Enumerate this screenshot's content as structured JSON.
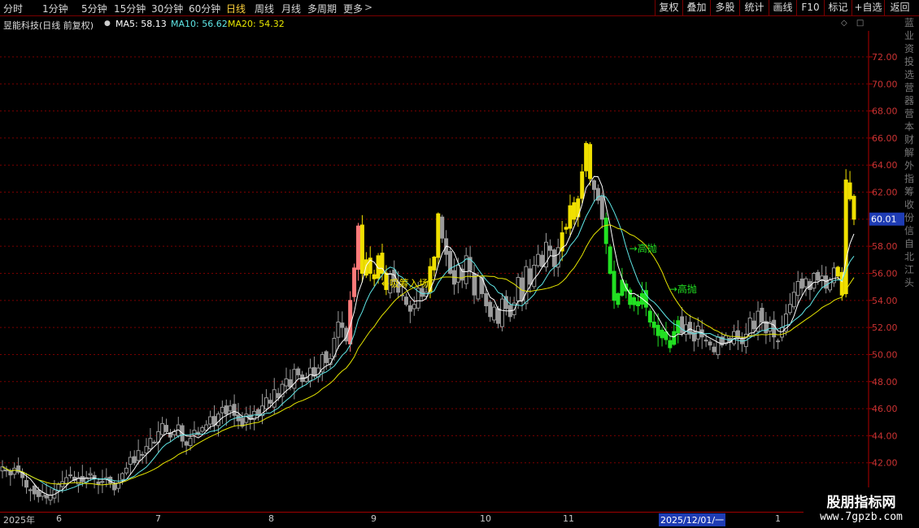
{
  "toolbar": {
    "periods": [
      "分时",
      "1分钟",
      "5分钟",
      "15分钟",
      "30分钟",
      "60分钟",
      "日线",
      "周线",
      "月线",
      "多周期",
      "更多"
    ],
    "active_period": "日线",
    "buttons": [
      "复权",
      "叠加",
      "多股",
      "统计",
      "画线",
      "F10",
      "标记",
      "+自选",
      "返回"
    ]
  },
  "info": {
    "stock": "昱能科技(日线 前复权)",
    "ma5": "MA5: 58.13",
    "ma10": "MA10: 56.62",
    "ma20": "MA20: 54.32",
    "colors": {
      "ma5": "#ffffff",
      "ma10": "#5fe6e6",
      "ma20": "#e6e600"
    }
  },
  "controls": {
    "diamond": "◇",
    "square": "□"
  },
  "right_panel": [
    "蓝",
    "业",
    "资",
    "投",
    "选",
    "营",
    "器",
    "营",
    "本",
    "财",
    "解",
    "外",
    "指",
    "筹",
    "收",
    "份",
    "信",
    "自",
    "北",
    "江",
    "头"
  ],
  "watermark": {
    "title": "股朋指标网",
    "url": "www.7gpzb.com"
  },
  "chart_data": {
    "type": "candlestick",
    "y_ticks": [
      "42.00",
      "44.00",
      "46.00",
      "48.00",
      "50.00",
      "52.00",
      "54.00",
      "56.00",
      "58.00",
      "60.00",
      "62.00",
      "64.00",
      "66.00",
      "68.00",
      "70.00",
      "72.00"
    ],
    "ylim": [
      38.5,
      73.5
    ],
    "current_price": "60.01",
    "x_labels": [
      "2025年",
      "6",
      "7",
      "8",
      "9",
      "10",
      "11",
      "2025/12/01/一",
      "1"
    ],
    "annotations": [
      "吸筹入场",
      "高抛",
      "高抛"
    ],
    "series": [
      {
        "name": "MA5",
        "color": "#ffffff"
      },
      {
        "name": "MA10",
        "color": "#5fe6e6"
      },
      {
        "name": "MA20",
        "color": "#e6e600"
      }
    ],
    "closes": [
      41.7,
      41.4,
      41.1,
      41.6,
      41.3,
      40.9,
      40.2,
      40.0,
      39.7,
      39.5,
      39.8,
      39.4,
      39.6,
      40.0,
      40.4,
      40.6,
      40.9,
      41.1,
      40.7,
      40.9,
      40.6,
      40.9,
      41.2,
      40.8,
      40.4,
      40.6,
      40.9,
      40.5,
      40.0,
      40.5,
      41.2,
      41.6,
      42.4,
      42.0,
      42.9,
      42.6,
      43.2,
      43.8,
      43.5,
      44.3,
      44.9,
      44.3,
      43.9,
      44.3,
      44.8,
      43.6,
      43.3,
      43.8,
      44.4,
      44.1,
      44.6,
      44.8,
      45.4,
      44.8,
      45.6,
      46.1,
      45.6,
      46.2,
      45.5,
      45.1,
      44.7,
      45.6,
      45.2,
      45.8,
      45.5,
      46.2,
      46.8,
      46.4,
      47.4,
      46.8,
      47.8,
      48.2,
      47.6,
      48.9,
      48.5,
      48.0,
      48.3,
      49.0,
      48.4,
      49.0,
      50.0,
      49.4,
      49.7,
      51.2,
      52.4,
      52.0,
      51.0,
      54.0,
      56.4,
      59.5,
      56.0,
      57.0,
      56.0,
      55.6,
      57.3,
      56.0,
      54.8,
      56.0,
      55.4,
      54.6,
      54.4,
      53.7,
      53.2,
      53.7,
      54.9,
      54.3,
      54.6,
      56.5,
      57.2,
      60.4,
      58.6,
      57.4,
      56.0,
      55.2,
      56.6,
      55.5,
      57.3,
      56.2,
      54.4,
      55.8,
      54.5,
      53.6,
      52.8,
      53.5,
      52.3,
      54.1,
      53.4,
      52.8,
      53.8,
      55.7,
      54.0,
      56.5,
      55.2,
      56.6,
      57.4,
      56.5,
      58.3,
      57.7,
      56.5,
      57.9,
      59.0,
      59.4,
      61.0,
      60.0,
      61.5,
      63.5,
      65.6,
      63.0,
      62.2,
      61.4,
      60.0,
      58.2,
      56.0,
      54.0,
      54.5,
      55.5,
      54.7,
      53.7,
      54.2,
      53.6,
      54.5,
      53.5,
      52.4,
      52.0,
      51.4,
      51.8,
      51.1,
      50.5,
      51.7,
      52.5,
      51.6,
      52.2,
      51.5,
      51.0,
      52.1,
      51.3,
      51.0,
      50.7,
      50.2,
      51.3,
      50.7,
      51.4,
      50.9,
      51.7,
      51.2,
      50.8,
      51.5,
      52.7,
      51.9,
      53.2,
      52.4,
      51.6,
      52.4,
      51.3,
      51.0,
      52.0,
      53.0,
      53.7,
      54.6,
      55.4,
      54.9,
      55.6,
      54.8,
      56.0,
      55.5,
      55.8,
      54.9,
      55.5,
      56.4,
      55.8,
      54.4,
      62.9,
      61.5,
      60.0
    ]
  }
}
